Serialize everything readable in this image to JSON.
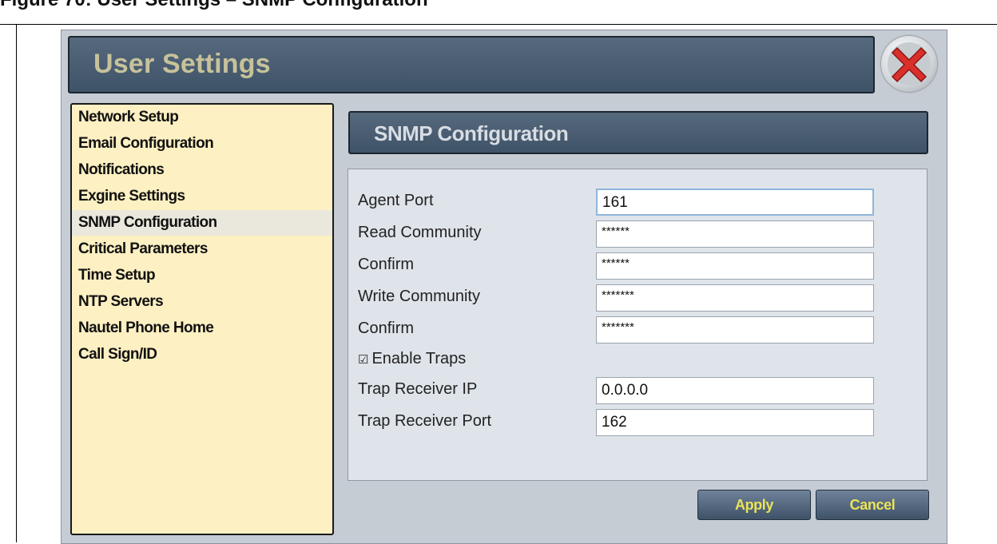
{
  "doc_caption": "Figure 70: User Settings – SNMP Configuration",
  "window": {
    "title": "User Settings"
  },
  "sidebar": {
    "items": [
      {
        "label": "Network Setup"
      },
      {
        "label": "Email Configuration"
      },
      {
        "label": "Notifications"
      },
      {
        "label": "Exgine Settings"
      },
      {
        "label": "SNMP Configuration",
        "selected": true
      },
      {
        "label": "Critical Parameters"
      },
      {
        "label": "Time Setup"
      },
      {
        "label": "NTP Servers"
      },
      {
        "label": "Nautel Phone Home"
      },
      {
        "label": "Call Sign/ID"
      }
    ]
  },
  "section": {
    "title": "SNMP Configuration"
  },
  "form": {
    "agent_port": {
      "label": "Agent Port",
      "value": "161"
    },
    "read_community": {
      "label": "Read Community",
      "value": "******"
    },
    "read_confirm": {
      "label": "Confirm",
      "value": "******"
    },
    "write_community": {
      "label": "Write Community",
      "value": "*******"
    },
    "write_confirm": {
      "label": "Confirm",
      "value": "*******"
    },
    "enable_traps": {
      "label": "Enable Traps",
      "checked": true,
      "box": "☑"
    },
    "trap_receiver_ip": {
      "label": "Trap Receiver IP",
      "value": "0.0.0.0"
    },
    "trap_receiver_port": {
      "label": "Trap Receiver Port",
      "value": "162"
    }
  },
  "buttons": {
    "apply": "Apply",
    "cancel": "Cancel"
  },
  "icons": {
    "close": "close-x-icon"
  },
  "colors": {
    "sidebar_bg": "#fdf0c2",
    "header_bg": "#47596d",
    "button_text": "#eae35a",
    "close_red": "#d9302c"
  }
}
